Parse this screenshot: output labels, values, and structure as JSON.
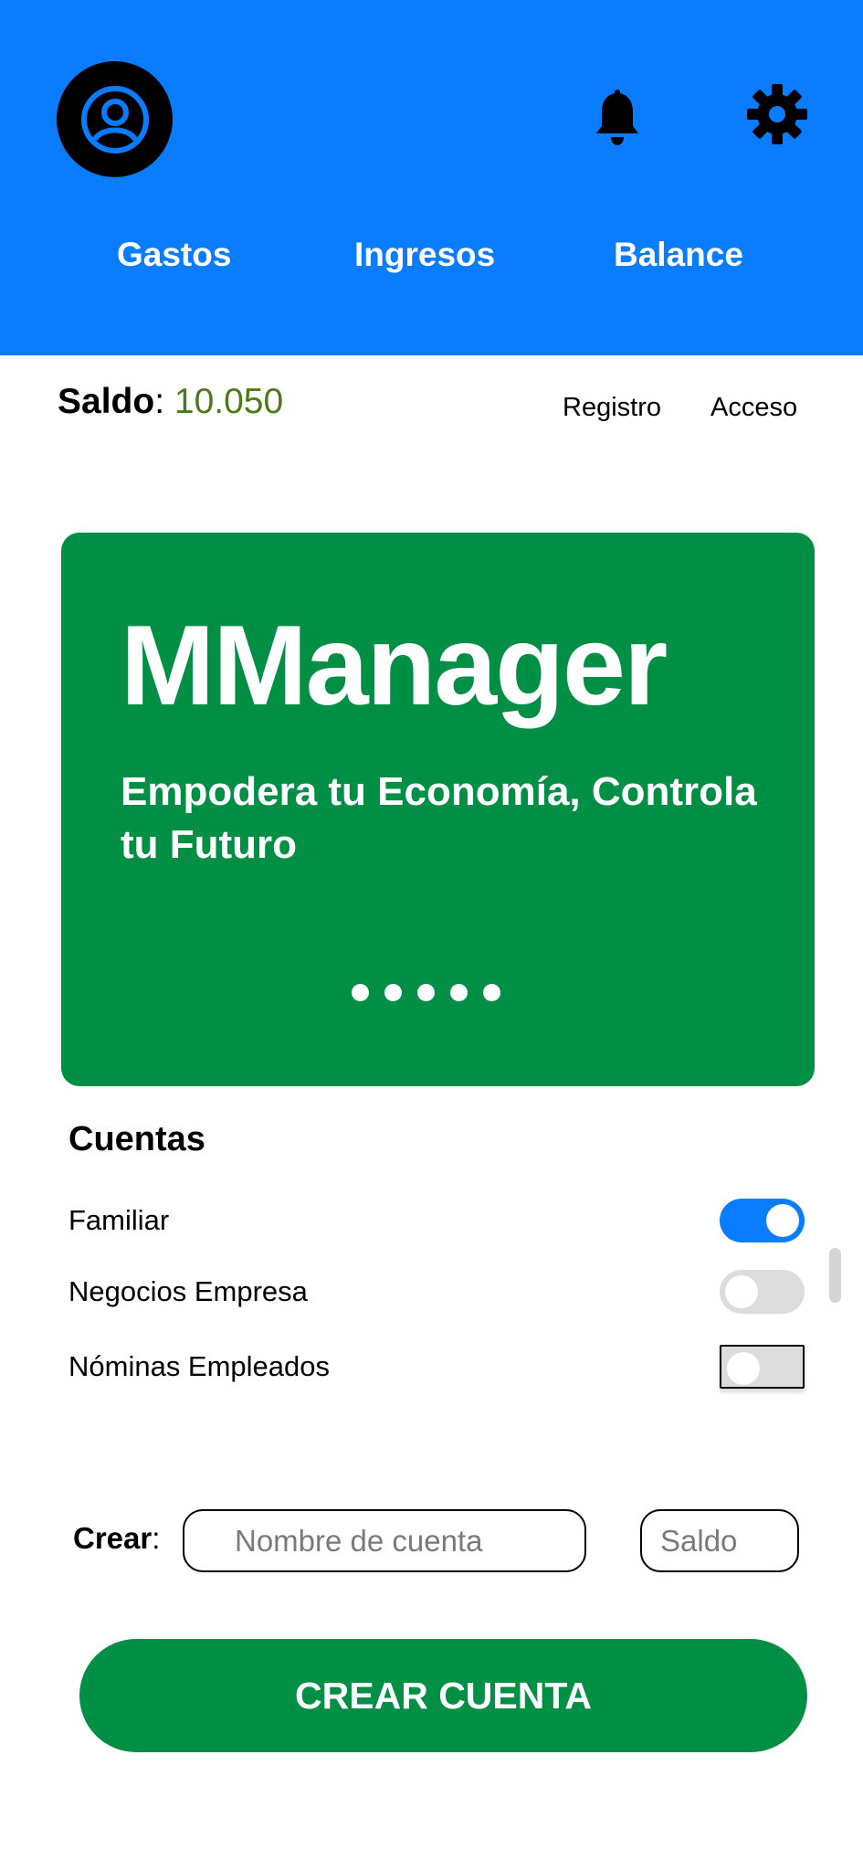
{
  "header": {
    "avatar_icon": "user-circle-icon",
    "notification_icon": "bell-icon",
    "settings_icon": "gear-icon",
    "tabs": [
      {
        "label": "Gastos"
      },
      {
        "label": "Ingresos"
      },
      {
        "label": "Balance"
      }
    ]
  },
  "balance": {
    "label": "Saldo",
    "separator": ":",
    "value": "10.050"
  },
  "auth": {
    "register": "Registro",
    "login": "Acceso"
  },
  "hero": {
    "title": "MManager",
    "subtitle": "Empodera tu Economía, Controla tu Futuro",
    "slide_count": 5
  },
  "accounts": {
    "title": "Cuentas",
    "items": [
      {
        "label": "Familiar",
        "enabled": true
      },
      {
        "label": "Negocios Empresa",
        "enabled": false
      },
      {
        "label": "Nóminas Empleados",
        "enabled": false
      }
    ]
  },
  "create": {
    "label": "Crear",
    "separator": ":",
    "name_placeholder": "Nombre de cuenta",
    "balance_placeholder": "Saldo",
    "button": "CREAR CUENTA"
  },
  "colors": {
    "header_bg": "#0a7cff",
    "brand_green": "#008f45",
    "balance_value": "#4a7a1a",
    "toggle_on": "#0a7cff",
    "toggle_off": "#dcdcdc"
  }
}
